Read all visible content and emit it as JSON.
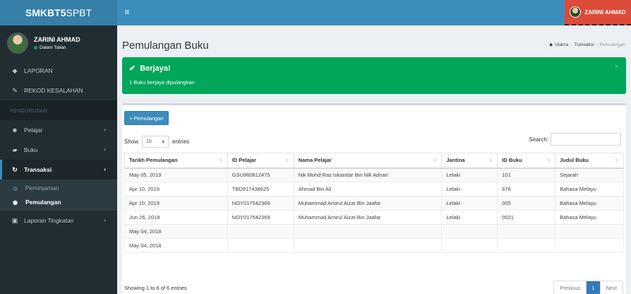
{
  "app": {
    "logo_bold": "SMKBT5",
    "logo_thin": "SPBT",
    "user_top": "ZARINI AHMAD"
  },
  "sidebar": {
    "user_name": "ZARINI AHMAD",
    "user_status": "Dalam Talian",
    "items": {
      "laporan": "LAPORAN",
      "rekod": "REKOD KESALAHAN",
      "header": "PENGURUSAN",
      "pelajar": "Pelajar",
      "buku": "Buku",
      "transaksi": "Transaksi",
      "peminjaman": "Peminjaman",
      "pemulangan": "Pemulangan",
      "laporan_tingkatan": "Laporan Tingkatan"
    }
  },
  "page": {
    "title": "Pemulangan Buku",
    "breadcrumb": {
      "home": "Utama",
      "section": "Transaksi",
      "current": "Pemulangan"
    }
  },
  "alert": {
    "title": "Berjaya!",
    "message": "1 Buku berjaya dipulangkan",
    "close": "×"
  },
  "toolbar": {
    "add_label": "Pemulangan"
  },
  "table_controls": {
    "show": "Show",
    "entries_value": "10",
    "entries": "entries",
    "search": "Search:"
  },
  "table": {
    "headers": [
      "Tarikh Pemulangan",
      "ID Pelajar",
      "Nama Pelajar",
      "Jantina",
      "ID Buku",
      "Judul Buku"
    ],
    "rows": [
      [
        "May 05, 2019",
        "GSU960812475",
        "Nik Mohd Ras Iskandar Bin Nik Adnan",
        "Lelaki",
        "101",
        "Sejarah"
      ],
      [
        "Apr 10, 2019",
        "TBD917438625",
        "Ahmad Bin Ali",
        "Lelaki",
        "676",
        "Bahasa Melayu"
      ],
      [
        "Apr 10, 2019",
        "NOY017542369",
        "Muhammad Amirul Aizat Bin Jaafar",
        "Lelaki",
        "005",
        "Bahasa Melayu"
      ],
      [
        "Jun 26, 2018",
        "NOY017542369",
        "Muhammad Amirul Aizat Bin Jaafar",
        "Lelaki",
        "0021",
        "Bahasa Melayu"
      ],
      [
        "May 04, 2018",
        "",
        "",
        "",
        "",
        ""
      ],
      [
        "May 04, 2018",
        "",
        "",
        "",
        "",
        ""
      ]
    ]
  },
  "footer": {
    "info": "Showing 1 to 6 of 6 entries",
    "previous": "Previous",
    "page": "1",
    "next": "Next"
  }
}
